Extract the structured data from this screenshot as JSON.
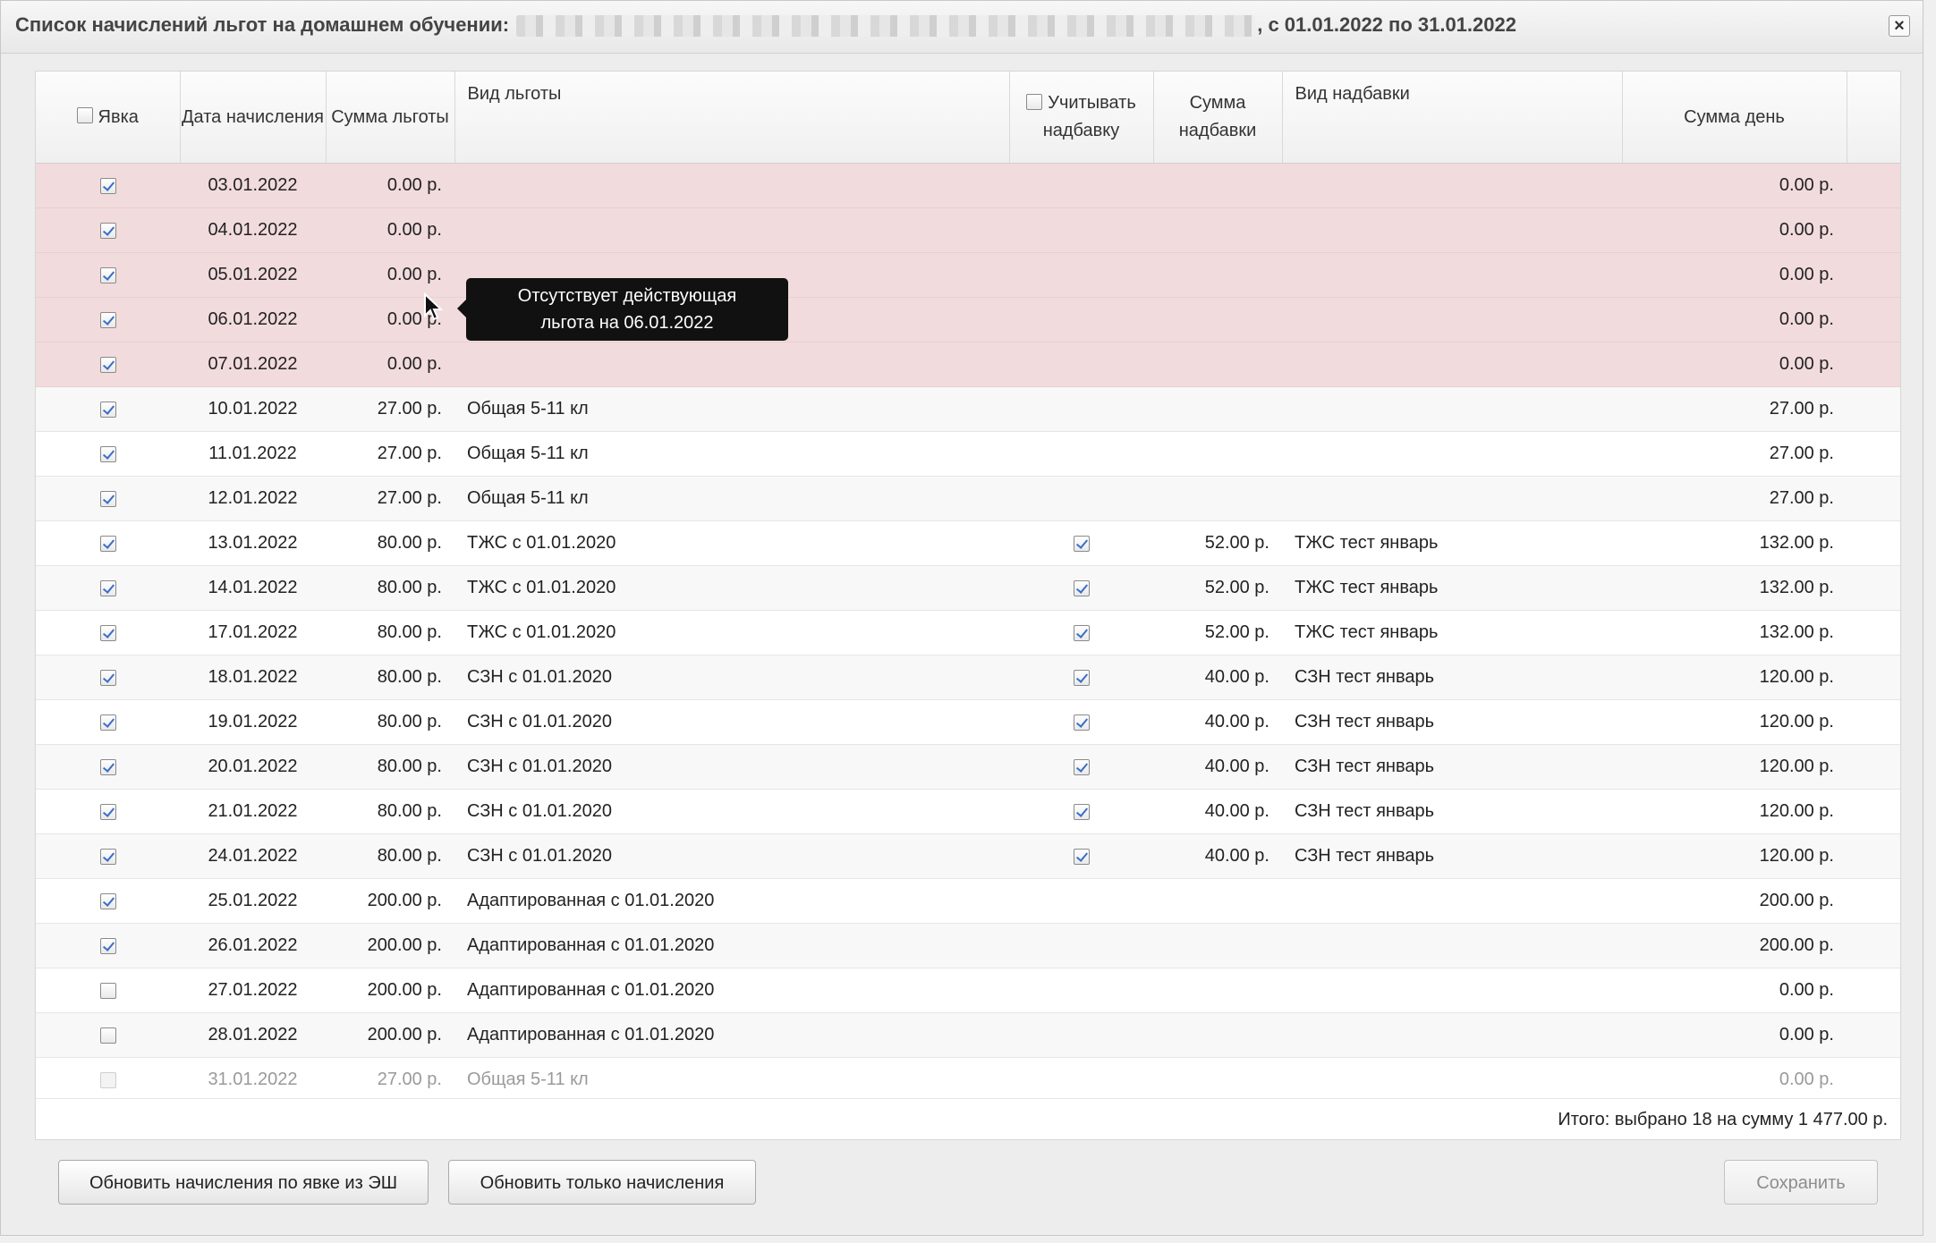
{
  "dialog": {
    "title_prefix": "Список начислений льгот на домашнем обучении:",
    "title_suffix": ", с 01.01.2022 по 31.01.2022",
    "close_label": "×"
  },
  "columns": {
    "attendance": "Явка",
    "date": "Дата начисления",
    "benefit_sum": "Сумма льготы",
    "benefit_type": "Вид льготы",
    "consider_bonus": "Учитывать надбавку",
    "bonus_sum": "Сумма надбавки",
    "bonus_type": "Вид надбавки",
    "day_sum": "Сумма день"
  },
  "rows": [
    {
      "checked": true,
      "date": "03.01.2022",
      "sum": "0.00 р.",
      "type": "",
      "bonus_on": false,
      "bonus_sum": "",
      "bonus_type": "",
      "day_sum": "0.00 р.",
      "state": "error"
    },
    {
      "checked": true,
      "date": "04.01.2022",
      "sum": "0.00 р.",
      "type": "",
      "bonus_on": false,
      "bonus_sum": "",
      "bonus_type": "",
      "day_sum": "0.00 р.",
      "state": "error"
    },
    {
      "checked": true,
      "date": "05.01.2022",
      "sum": "0.00 р.",
      "type": "",
      "bonus_on": false,
      "bonus_sum": "",
      "bonus_type": "",
      "day_sum": "0.00 р.",
      "state": "error"
    },
    {
      "checked": true,
      "date": "06.01.2022",
      "sum": "0.00 р.",
      "type": "",
      "bonus_on": false,
      "bonus_sum": "",
      "bonus_type": "",
      "day_sum": "0.00 р.",
      "state": "error"
    },
    {
      "checked": true,
      "date": "07.01.2022",
      "sum": "0.00 р.",
      "type": "",
      "bonus_on": false,
      "bonus_sum": "",
      "bonus_type": "",
      "day_sum": "0.00 р.",
      "state": "error"
    },
    {
      "checked": true,
      "date": "10.01.2022",
      "sum": "27.00 р.",
      "type": "Общая 5-11 кл",
      "bonus_on": false,
      "bonus_sum": "",
      "bonus_type": "",
      "day_sum": "27.00 р.",
      "state": "normal"
    },
    {
      "checked": true,
      "date": "11.01.2022",
      "sum": "27.00 р.",
      "type": "Общая 5-11 кл",
      "bonus_on": false,
      "bonus_sum": "",
      "bonus_type": "",
      "day_sum": "27.00 р.",
      "state": "normal"
    },
    {
      "checked": true,
      "date": "12.01.2022",
      "sum": "27.00 р.",
      "type": "Общая 5-11 кл",
      "bonus_on": false,
      "bonus_sum": "",
      "bonus_type": "",
      "day_sum": "27.00 р.",
      "state": "normal"
    },
    {
      "checked": true,
      "date": "13.01.2022",
      "sum": "80.00 р.",
      "type": "ТЖС с 01.01.2020",
      "bonus_on": true,
      "bonus_sum": "52.00 р.",
      "bonus_type": "ТЖС тест январь",
      "day_sum": "132.00 р.",
      "state": "normal"
    },
    {
      "checked": true,
      "date": "14.01.2022",
      "sum": "80.00 р.",
      "type": "ТЖС с 01.01.2020",
      "bonus_on": true,
      "bonus_sum": "52.00 р.",
      "bonus_type": "ТЖС тест январь",
      "day_sum": "132.00 р.",
      "state": "normal"
    },
    {
      "checked": true,
      "date": "17.01.2022",
      "sum": "80.00 р.",
      "type": "ТЖС с 01.01.2020",
      "bonus_on": true,
      "bonus_sum": "52.00 р.",
      "bonus_type": "ТЖС тест январь",
      "day_sum": "132.00 р.",
      "state": "normal"
    },
    {
      "checked": true,
      "date": "18.01.2022",
      "sum": "80.00 р.",
      "type": "СЗН с 01.01.2020",
      "bonus_on": true,
      "bonus_sum": "40.00 р.",
      "bonus_type": "СЗН тест январь",
      "day_sum": "120.00 р.",
      "state": "normal"
    },
    {
      "checked": true,
      "date": "19.01.2022",
      "sum": "80.00 р.",
      "type": "СЗН с 01.01.2020",
      "bonus_on": true,
      "bonus_sum": "40.00 р.",
      "bonus_type": "СЗН тест январь",
      "day_sum": "120.00 р.",
      "state": "normal"
    },
    {
      "checked": true,
      "date": "20.01.2022",
      "sum": "80.00 р.",
      "type": "СЗН с 01.01.2020",
      "bonus_on": true,
      "bonus_sum": "40.00 р.",
      "bonus_type": "СЗН тест январь",
      "day_sum": "120.00 р.",
      "state": "normal"
    },
    {
      "checked": true,
      "date": "21.01.2022",
      "sum": "80.00 р.",
      "type": "СЗН с 01.01.2020",
      "bonus_on": true,
      "bonus_sum": "40.00 р.",
      "bonus_type": "СЗН тест январь",
      "day_sum": "120.00 р.",
      "state": "normal"
    },
    {
      "checked": true,
      "date": "24.01.2022",
      "sum": "80.00 р.",
      "type": "СЗН с 01.01.2020",
      "bonus_on": true,
      "bonus_sum": "40.00 р.",
      "bonus_type": "СЗН тест январь",
      "day_sum": "120.00 р.",
      "state": "normal"
    },
    {
      "checked": true,
      "date": "25.01.2022",
      "sum": "200.00 р.",
      "type": "Адаптированная с 01.01.2020",
      "bonus_on": false,
      "bonus_sum": "",
      "bonus_type": "",
      "day_sum": "200.00 р.",
      "state": "normal"
    },
    {
      "checked": true,
      "date": "26.01.2022",
      "sum": "200.00 р.",
      "type": "Адаптированная с 01.01.2020",
      "bonus_on": false,
      "bonus_sum": "",
      "bonus_type": "",
      "day_sum": "200.00 р.",
      "state": "normal"
    },
    {
      "checked": false,
      "date": "27.01.2022",
      "sum": "200.00 р.",
      "type": "Адаптированная с 01.01.2020",
      "bonus_on": false,
      "bonus_sum": "",
      "bonus_type": "",
      "day_sum": "0.00 р.",
      "state": "normal"
    },
    {
      "checked": false,
      "date": "28.01.2022",
      "sum": "200.00 р.",
      "type": "Адаптированная с 01.01.2020",
      "bonus_on": false,
      "bonus_sum": "",
      "bonus_type": "",
      "day_sum": "0.00 р.",
      "state": "normal"
    },
    {
      "checked": false,
      "date": "31.01.2022",
      "sum": "27.00 р.",
      "type": "Общая 5-11 кл",
      "bonus_on": false,
      "bonus_sum": "",
      "bonus_type": "",
      "day_sum": "0.00 р.",
      "state": "disabled"
    }
  ],
  "tooltip": {
    "line1": "Отсутствует действующая",
    "line2": "льгота на 06.01.2022"
  },
  "total": "Итого: выбрано 18 на сумму 1 477.00 р.",
  "buttons": {
    "refresh_from_attendance": "Обновить начисления по явке из ЭШ",
    "refresh_only": "Обновить только начисления",
    "save": "Сохранить"
  },
  "colors": {
    "error_row": "#f2dbdd",
    "checkbox_check": "#3a6ec9"
  },
  "icons": {
    "close": "close-icon",
    "cursor": "mouse-pointer-icon"
  }
}
